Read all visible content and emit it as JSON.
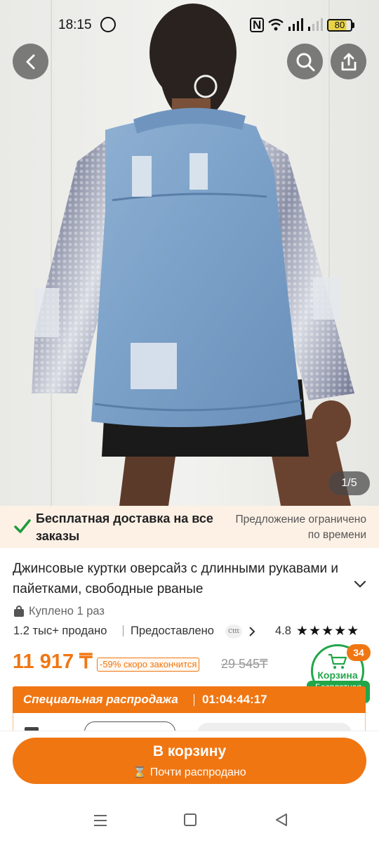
{
  "status_bar": {
    "time": "18:15",
    "battery": "80",
    "nfc": "N"
  },
  "gallery": {
    "counter": "1/5"
  },
  "shipping_banner": {
    "title": "Бесплатная доставка на все заказы",
    "limited": "Предложение ограничено по времени"
  },
  "product": {
    "title": "Джинсовые куртки оверсайз с длинными рукавами и пайетками, свободные рваные",
    "bought": "Куплено 1 раз",
    "sold": "1.2 тыс+ продано",
    "provided_by": "Предоставлено",
    "seller_logo_text": "Cttt",
    "rating": "4.8",
    "stars": "★★★★★",
    "price": "11 917 ₸",
    "discount": "-59% скоро закончится",
    "old_price": "29 545₸"
  },
  "cart_badge": {
    "count": "34",
    "label": "Корзина",
    "free_delivery": "Бесплатная доставка"
  },
  "sale": {
    "label": "Специальная распродажа",
    "timer": "01:04:44:17"
  },
  "add_to_cart": {
    "label": "В корзину",
    "sub": "⌛ Почти распродано"
  },
  "colors": {
    "accent": "#f07612",
    "green": "#22a64a"
  }
}
